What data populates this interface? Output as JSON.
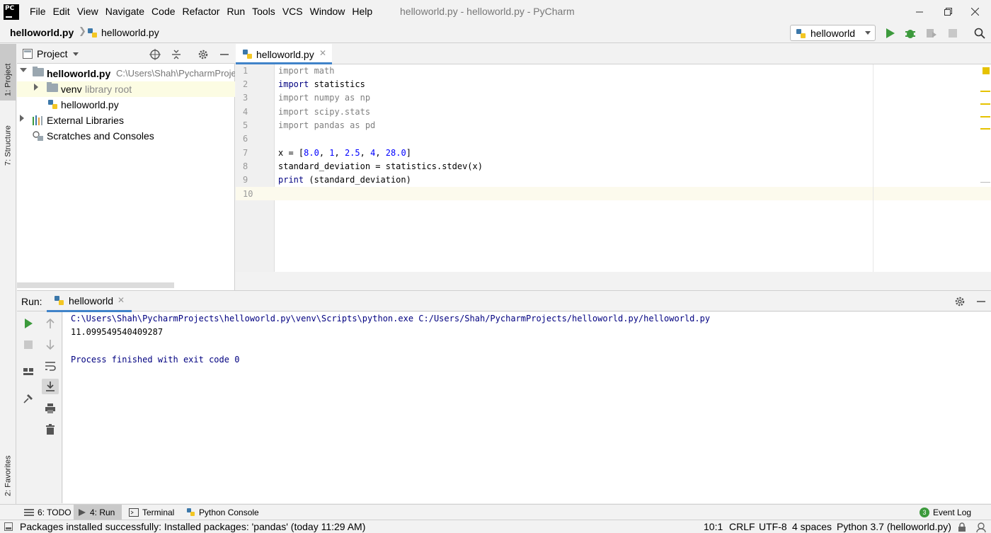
{
  "menu": {
    "items": [
      "File",
      "Edit",
      "View",
      "Navigate",
      "Code",
      "Refactor",
      "Run",
      "Tools",
      "VCS",
      "Window",
      "Help"
    ]
  },
  "window": {
    "title": "helloworld.py - helloworld.py - PyCharm"
  },
  "navbar": {
    "project": "helloworld.py",
    "file": "helloworld.py",
    "run_config": "helloworld"
  },
  "left_strip": {
    "project_tab": "1: Project",
    "structure_tab": "7: Structure",
    "favorites_tab": "2: Favorites"
  },
  "project_panel": {
    "title": "Project",
    "root_name": "helloworld.py",
    "root_path": "C:\\Users\\Shah\\PycharmProjects\\helloworld.py",
    "venv_name": "venv",
    "venv_note": "library root",
    "file_name": "helloworld.py",
    "external_libraries": "External Libraries",
    "scratches": "Scratches and Consoles"
  },
  "editor": {
    "tab_label": "helloworld.py",
    "line_numbers": [
      "1",
      "2",
      "3",
      "4",
      "5",
      "6",
      "7",
      "8",
      "9",
      "10"
    ],
    "code": {
      "l1": "import math",
      "l2_kw": "import",
      "l2_rest": " statistics",
      "l3": "import numpy as np",
      "l4": "import scipy.stats",
      "l5": "import pandas as pd",
      "l7_a": "x = [",
      "l7_n1": "8.0",
      "l7_s1": ", ",
      "l7_n2": "1",
      "l7_s2": ", ",
      "l7_n3": "2.5",
      "l7_s3": ", ",
      "l7_n4": "4",
      "l7_s4": ", ",
      "l7_n5": "28.0",
      "l7_b": "]",
      "l8": "standard_deviation = statistics.stdev(x)",
      "l9_kw": "print",
      "l9_rest": " (standard_deviation)"
    }
  },
  "run_panel": {
    "label": "Run:",
    "tab_label": "helloworld",
    "console": {
      "command": "C:\\Users\\Shah\\PycharmProjects\\helloworld.py\\venv\\Scripts\\python.exe C:/Users/Shah/PycharmProjects/helloworld.py/helloworld.py",
      "result": "11.099549540409287",
      "exit": "Process finished with exit code 0"
    }
  },
  "bottom_tabs": {
    "todo": "6: TODO",
    "run": "4: Run",
    "terminal": "Terminal",
    "python_console": "Python Console",
    "event_log": "Event Log",
    "event_count": "3"
  },
  "statusbar": {
    "message": "Packages installed successfully: Installed packages: 'pandas' (today 11:29 AM)",
    "position": "10:1",
    "line_sep": "CRLF",
    "encoding": "UTF-8",
    "indent": "4 spaces",
    "interpreter": "Python 3.7 (helloworld.py)"
  },
  "colors": {
    "accent": "#4083c9",
    "keyword": "#000080",
    "number": "#0000ff",
    "run_green": "#3c9a3c",
    "marker": "#e6c200"
  }
}
